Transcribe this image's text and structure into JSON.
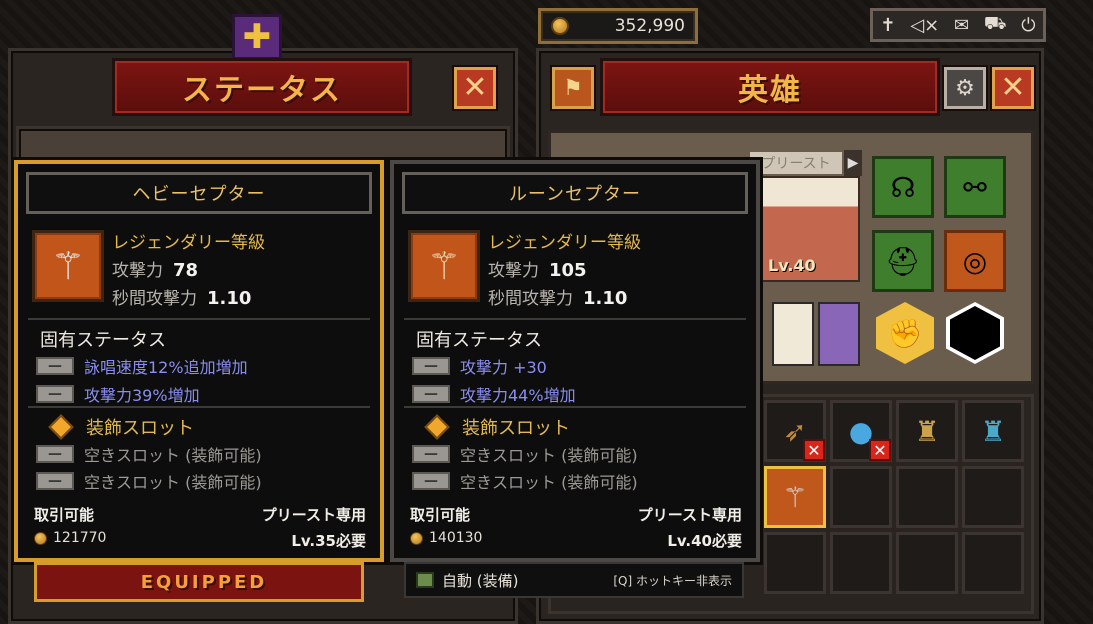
{
  "status_panel": {
    "title": "ステータス",
    "close_icon": "close-x-icon"
  },
  "hero_panel": {
    "title": "英雄",
    "tab_label": "プリースト",
    "level": "Lv.40",
    "left_button_icon": "flag-icon",
    "settings_icon": "gear-icon",
    "close_icon": "close-x-icon"
  },
  "currency": {
    "gold": "352,990",
    "icon": "coin-icon"
  },
  "topbar": {
    "icons": [
      "sword-icon",
      "sound-icon",
      "mail-icon",
      "cart-icon",
      "power-icon"
    ]
  },
  "tooltip_left": {
    "name": "ヘビーセプター",
    "grade": "レジェンダリー等級",
    "attack_label": "攻撃力",
    "attack_value": "78",
    "speed_label": "秒間攻撃力",
    "speed_value": "1.10",
    "inherent_title": "固有ステータス",
    "inherent": [
      "詠唱速度12%追加増加",
      "攻撃力39%増加"
    ],
    "slot_title": "装飾スロット",
    "slots": [
      "空きスロット (装飾可能)",
      "空きスロット (装飾可能)"
    ],
    "tradable": "取引可能",
    "class_only": "プリースト専用",
    "price": "121770",
    "level_req": "Lv.35必要",
    "status_button": "EQUIPPED"
  },
  "tooltip_right": {
    "name": "ルーンセプター",
    "grade": "レジェンダリー等級",
    "attack_label": "攻撃力",
    "attack_value": "105",
    "speed_label": "秒間攻撃力",
    "speed_value": "1.10",
    "inherent_title": "固有ステータス",
    "inherent": [
      "攻撃力 +30",
      "攻撃力44%増加"
    ],
    "slot_title": "装飾スロット",
    "slots": [
      "空きスロット (装飾可能)",
      "空きスロット (装飾可能)"
    ],
    "tradable": "取引可能",
    "class_only": "プリースト専用",
    "price": "140130",
    "level_req": "Lv.40必要",
    "auto_label": "自動 (装備)",
    "hotkey_hint": "[Q] ホットキー非表示"
  },
  "colors": {
    "banner_red": "#7d1512",
    "gold_text": "#f1b54a",
    "legendary": "#e6b94c",
    "blue_stat": "#8b8df0",
    "equipped_border": "#d79d2b"
  }
}
